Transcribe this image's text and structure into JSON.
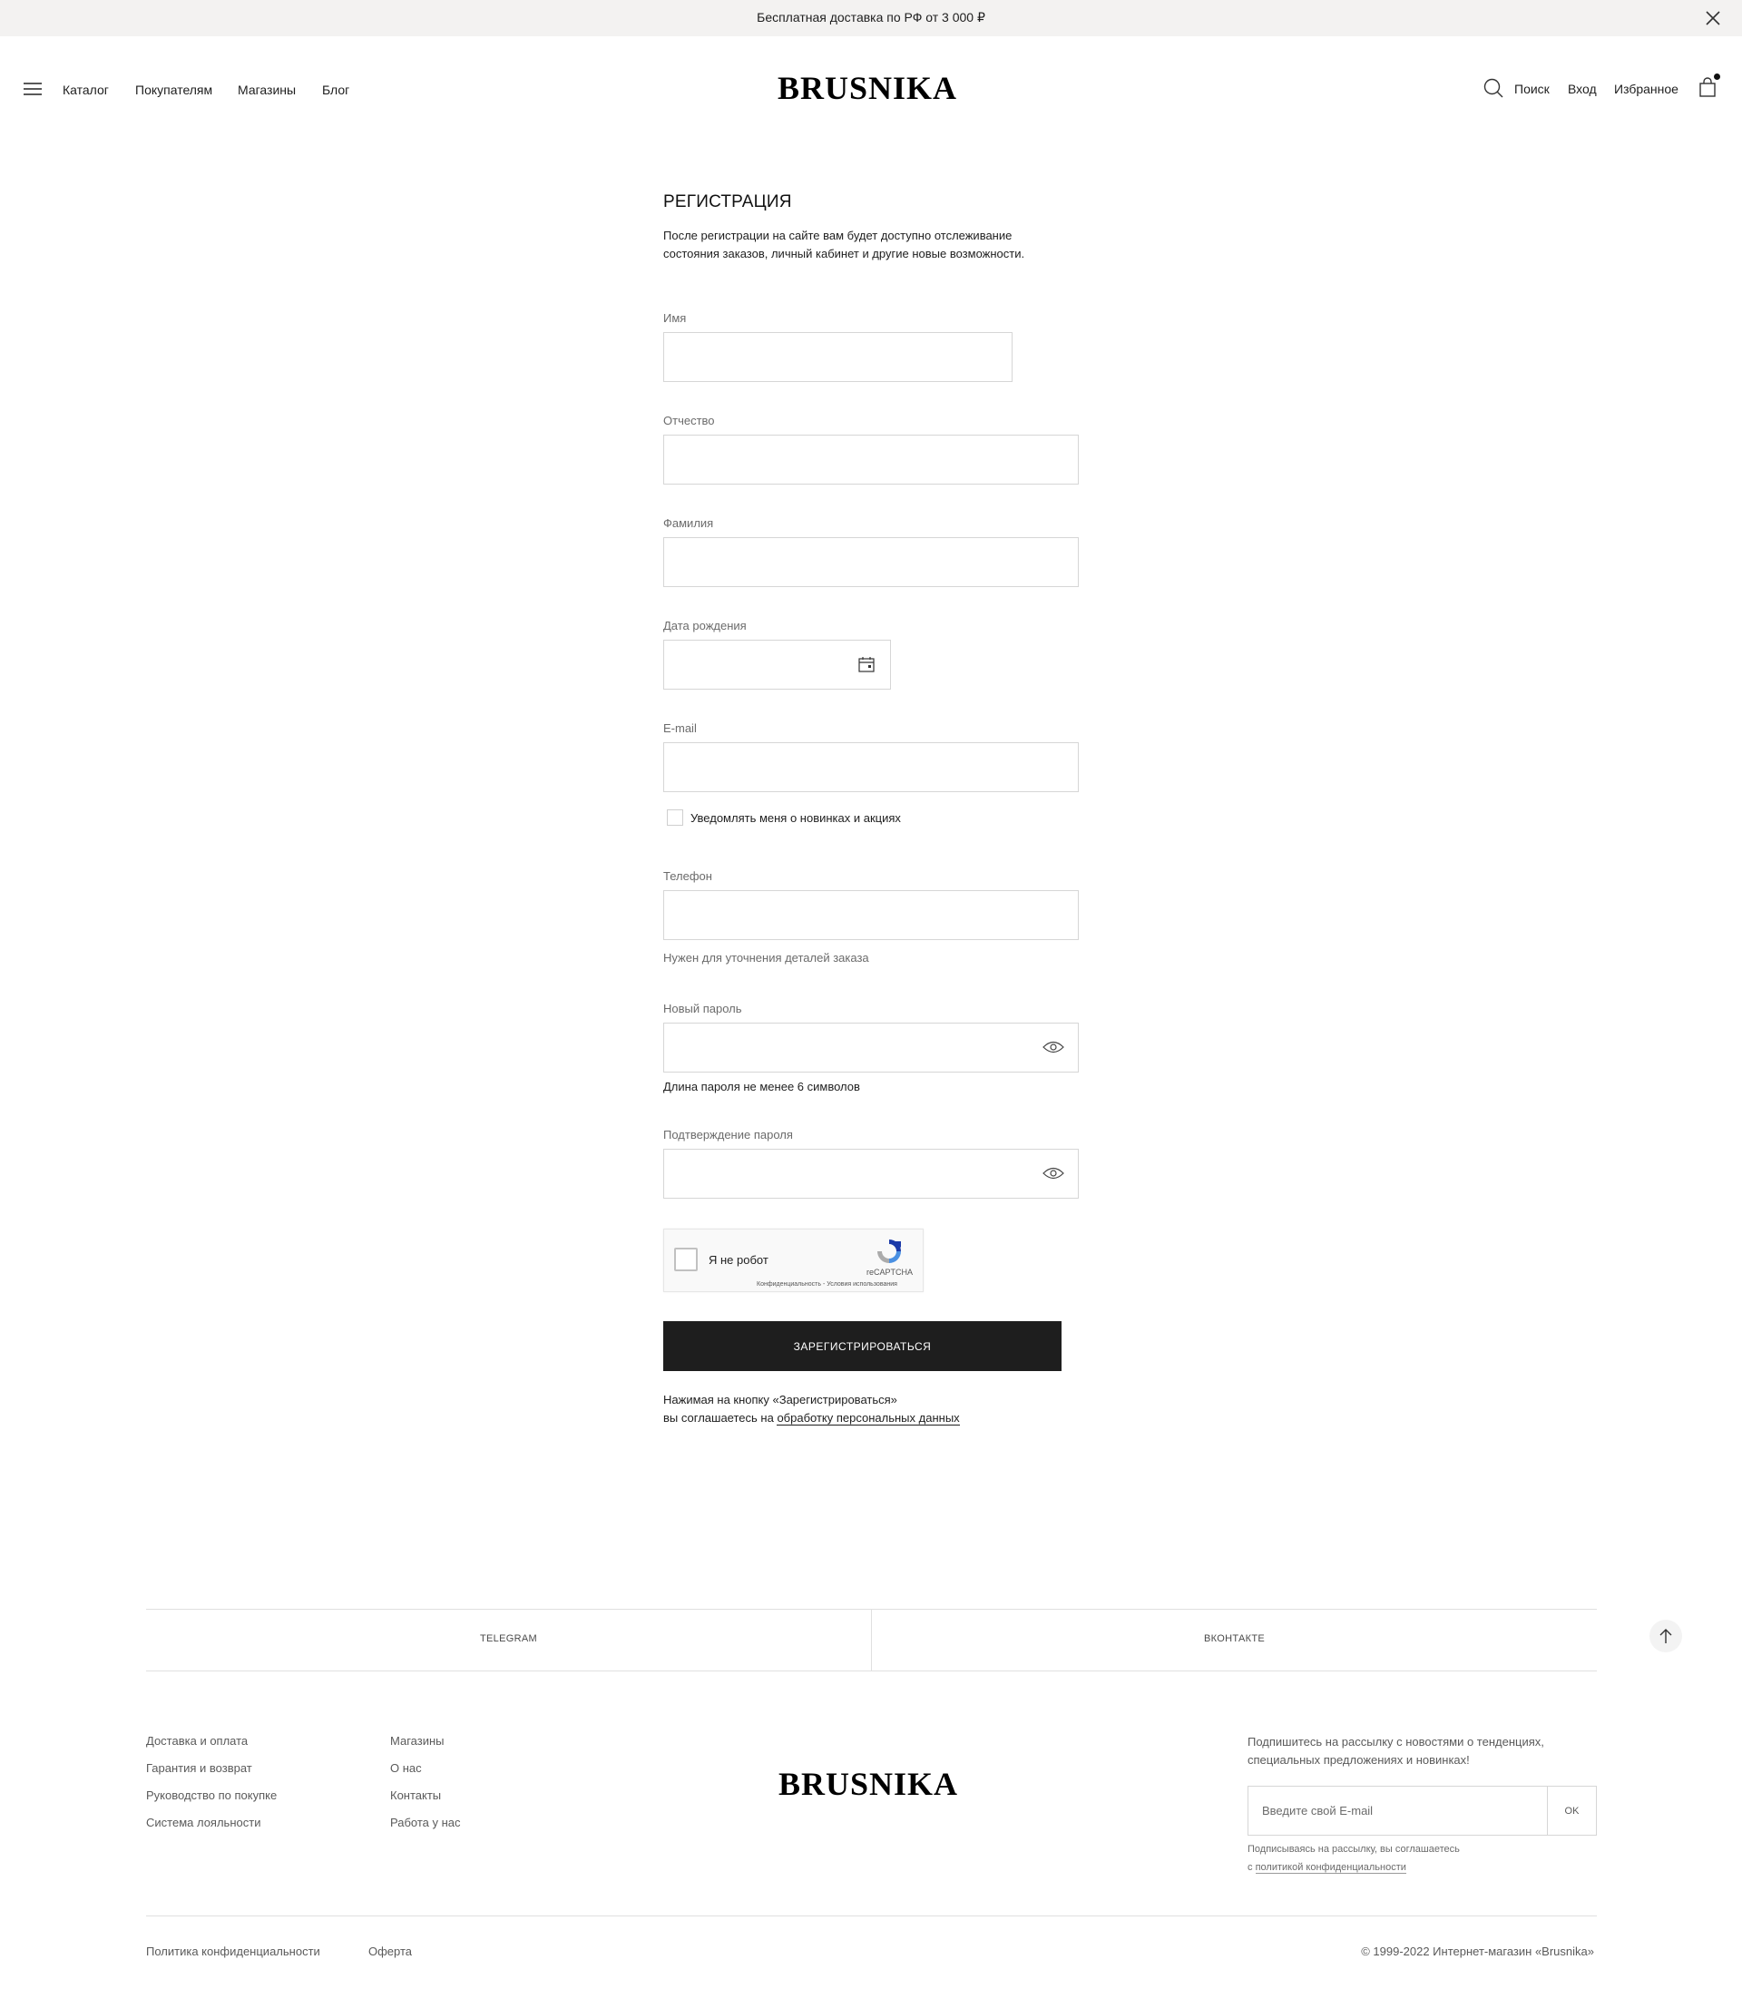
{
  "announcement": {
    "text": "Бесплатная доставка по РФ от 3 000 ₽"
  },
  "header": {
    "logo": "BRUSNIKA",
    "nav": [
      "Каталог",
      "Покупателям",
      "Магазины",
      "Блог"
    ],
    "search_label": "Поиск",
    "login_label": "Вход",
    "favorites_label": "Избранное"
  },
  "form": {
    "title": "РЕГИСТРАЦИЯ",
    "description": "После регистрации на сайте вам будет доступно отслеживание состояния заказов, личный кабинет и другие новые возможности.",
    "fields": {
      "first_name": {
        "label": "Имя",
        "value": ""
      },
      "patronymic": {
        "label": "Отчество",
        "value": ""
      },
      "last_name": {
        "label": "Фамилия",
        "value": ""
      },
      "birth_date": {
        "label": "Дата рождения",
        "value": ""
      },
      "email": {
        "label": "E-mail",
        "value": ""
      },
      "phone": {
        "label": "Телефон",
        "value": "",
        "hint": "Нужен для уточнения деталей заказа"
      },
      "password": {
        "label": "Новый пароль",
        "value": "",
        "hint": "Длина пароля не менее 6 символов"
      },
      "password_confirm": {
        "label": "Подтверждение пароля",
        "value": ""
      }
    },
    "subscribe_checkbox": {
      "label": "Уведомлять меня о новинках и акциях",
      "checked": false
    },
    "captcha": {
      "label": "Я не робот",
      "brand": "reCAPTCHA",
      "links": "Конфиденциальность - Условия использования",
      "checked": false
    },
    "submit_label": "ЗАРЕГИСТРИРОВАТЬСЯ",
    "agreement_line1": "Нажимая на кнопку «Зарегистрироваться»",
    "agreement_prefix": "вы соглашаетесь на",
    "agreement_link": "обработку персональных данных"
  },
  "social": {
    "telegram": "TELEGRAM",
    "vk": "ВКОНТАКТЕ"
  },
  "footer": {
    "logo": "BRUSNIKA",
    "col1": [
      "Доставка и оплата",
      "Гарантия и возврат",
      "Руководство по покупке",
      "Система лояльности"
    ],
    "col2": [
      "Магазины",
      "О нас",
      "Контакты",
      "Работа у нас"
    ],
    "subscribe_text": "Подпишитесь на рассылку с новостями о тенденциях, специальных предложениях и новинках!",
    "subscribe_placeholder": "Введите свой E-mail",
    "subscribe_button": "OK",
    "subscribe_note_line1": "Подписываясь на рассылку, вы соглашаетесь",
    "subscribe_note_prefix": "с",
    "subscribe_note_link": "политикой конфиденциальности",
    "privacy_label": "Политика конфиденциальности",
    "offer_label": "Оферта",
    "copyright": "© 1999-2022 Интернет-магазин «Brusnika»"
  },
  "colors": {
    "button_bg": "#1e1e1e",
    "topbar_bg": "#f3f2f1",
    "border": "#d6d6d6"
  }
}
